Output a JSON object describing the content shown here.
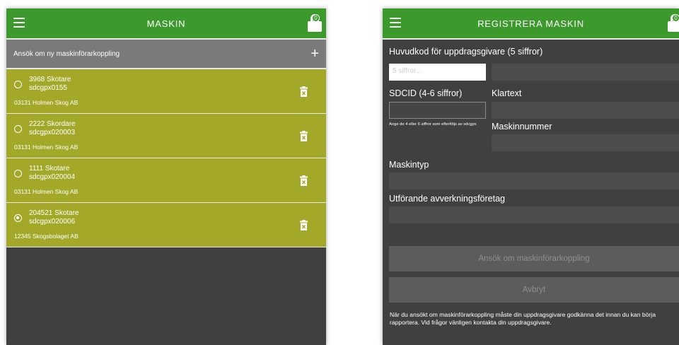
{
  "left": {
    "title": "MASKIN",
    "lock_badge": "0",
    "apply_label": "Ansök om ny maskinförarkoppling",
    "apply_icon": "+",
    "machines": [
      {
        "name": "3968 Skotare",
        "code": "sdcgpx0155",
        "org": "03131 Holmen Skog AB",
        "selected": false
      },
      {
        "name": "2222 Skordare",
        "code": "sdcgpx020003",
        "org": "03131 Holmen Skog AB",
        "selected": false
      },
      {
        "name": "1111 Skotare",
        "code": "sdcgpx020004",
        "org": "03131 Holmen Skog AB",
        "selected": false
      },
      {
        "name": "204521 Skotare",
        "code": "sdcgpx020006",
        "org": "12345 Skogsbolaget AB",
        "selected": true
      }
    ]
  },
  "right": {
    "title": "REGISTRERA MASKIN",
    "lock_badge": "0",
    "huvudkod_label": "Huvudkod för uppdragsgivare (5 siffror)",
    "huvudkod_placeholder": "5 siffror...",
    "sdcid_label": "SDCID (4-6 siffror)",
    "sdcid_hint": "Ange de 4 eller 6 siffror som efterföljs av sdcgpx",
    "klartext_label": "Klartext",
    "maskinnummer_label": "Maskinnummer",
    "maskintyp_label": "Maskintyp",
    "utforande_label": "Utförande avverkningsföretag",
    "apply_button": "Ansök om maskinförarkoppling",
    "cancel_button": "Avbryt",
    "note": "När du ansökt om maskinförarkoppling måste din uppdragsgivare godkänna det innan du kan börja rapportera. Vid frågor vänligen kontakta din uppdragsgivare."
  },
  "colors": {
    "brand_green": "#3c9a2c",
    "row_olive": "#a3a828",
    "panel_dark": "#404040"
  }
}
